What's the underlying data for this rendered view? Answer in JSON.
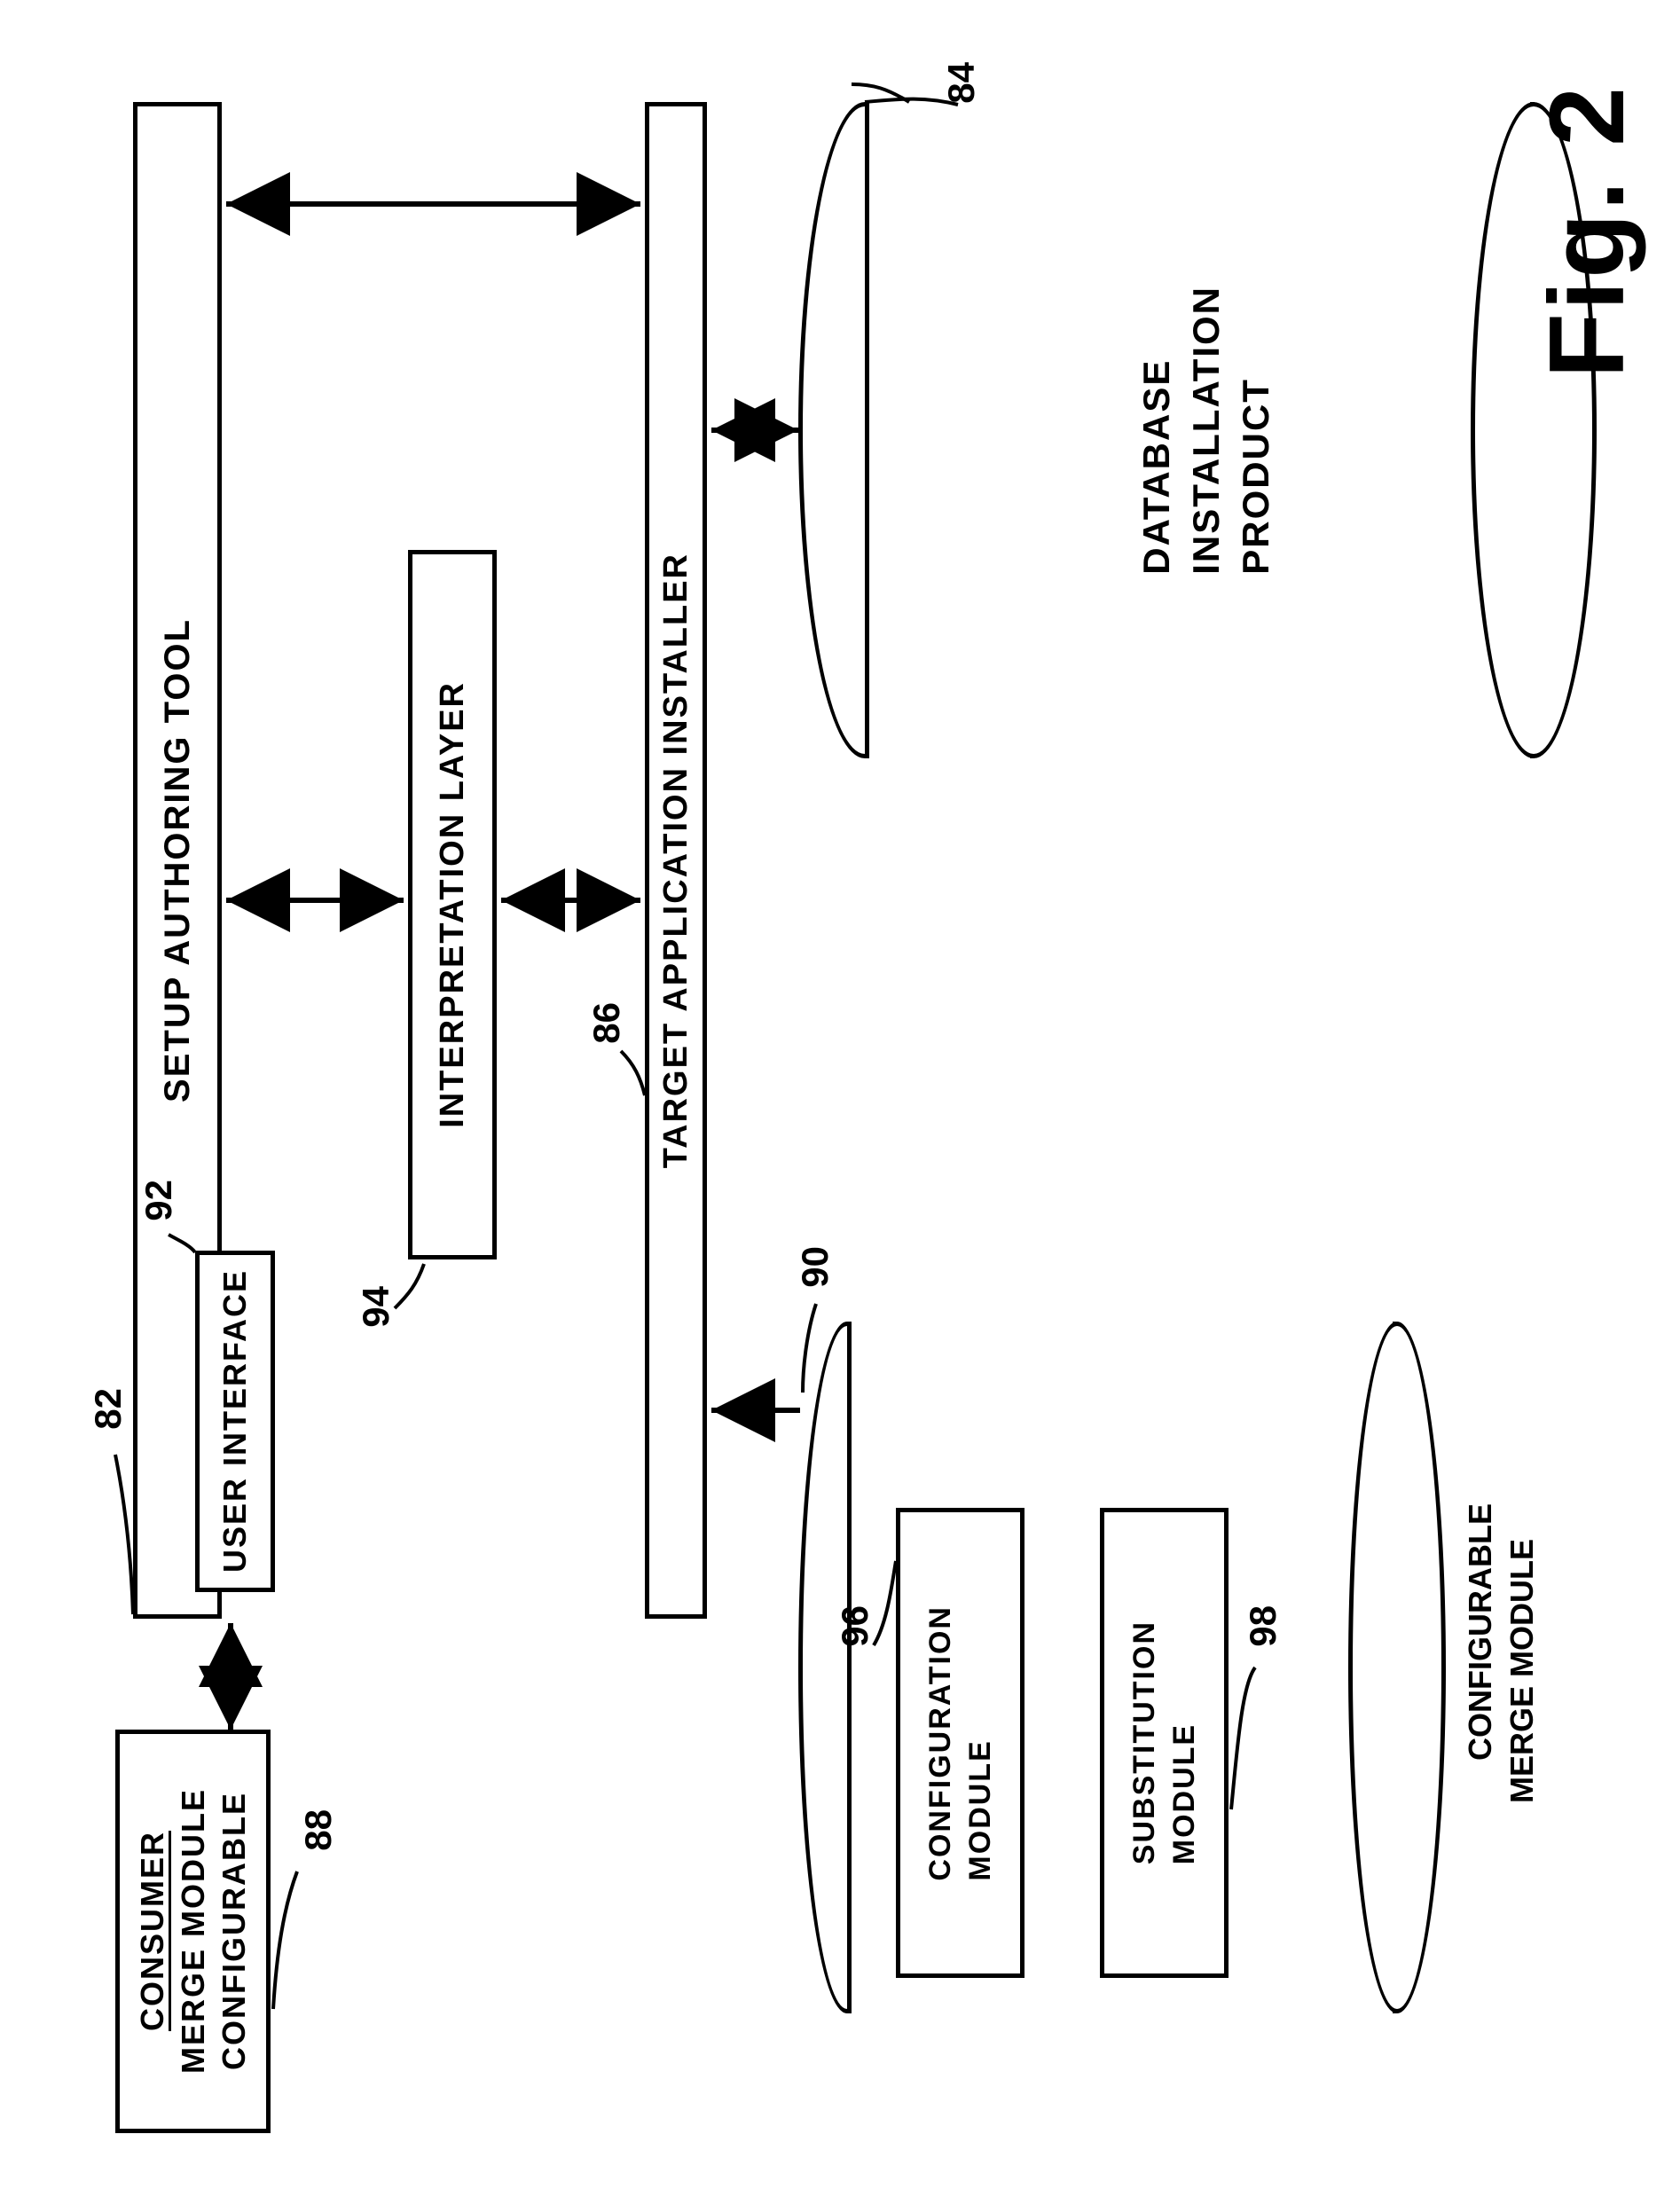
{
  "figure_label": "Fig. 2",
  "boxes": {
    "setup_authoring_tool": "SETUP AUTHORING TOOL",
    "user_interface": "USER INTERFACE",
    "cmm_consumer_line1": "CONFIGURABLE",
    "cmm_consumer_line2": "MERGE MODULE",
    "cmm_consumer_line3": "CONSUMER",
    "interpretation_layer": "INTERPRETATION LAYER",
    "target_app_installer": "TARGET APPLICATION INSTALLER",
    "product_install_db_line1": "PRODUCT",
    "product_install_db_line2": "INSTALLATION",
    "product_install_db_line3": "DATABASE",
    "module_config_line1": "MODULE",
    "module_config_line2": "CONFIGURATION",
    "module_sub_line1": "MODULE",
    "module_sub_line2": "SUBSTITUTION",
    "cmm_caption_line1": "CONFIGURABLE",
    "cmm_caption_line2": "MERGE MODULE"
  },
  "refs": {
    "r82": "82",
    "r84": "84",
    "r86": "86",
    "r88": "88",
    "r90": "90",
    "r92": "92",
    "r94": "94",
    "r96": "96",
    "r98": "98"
  }
}
